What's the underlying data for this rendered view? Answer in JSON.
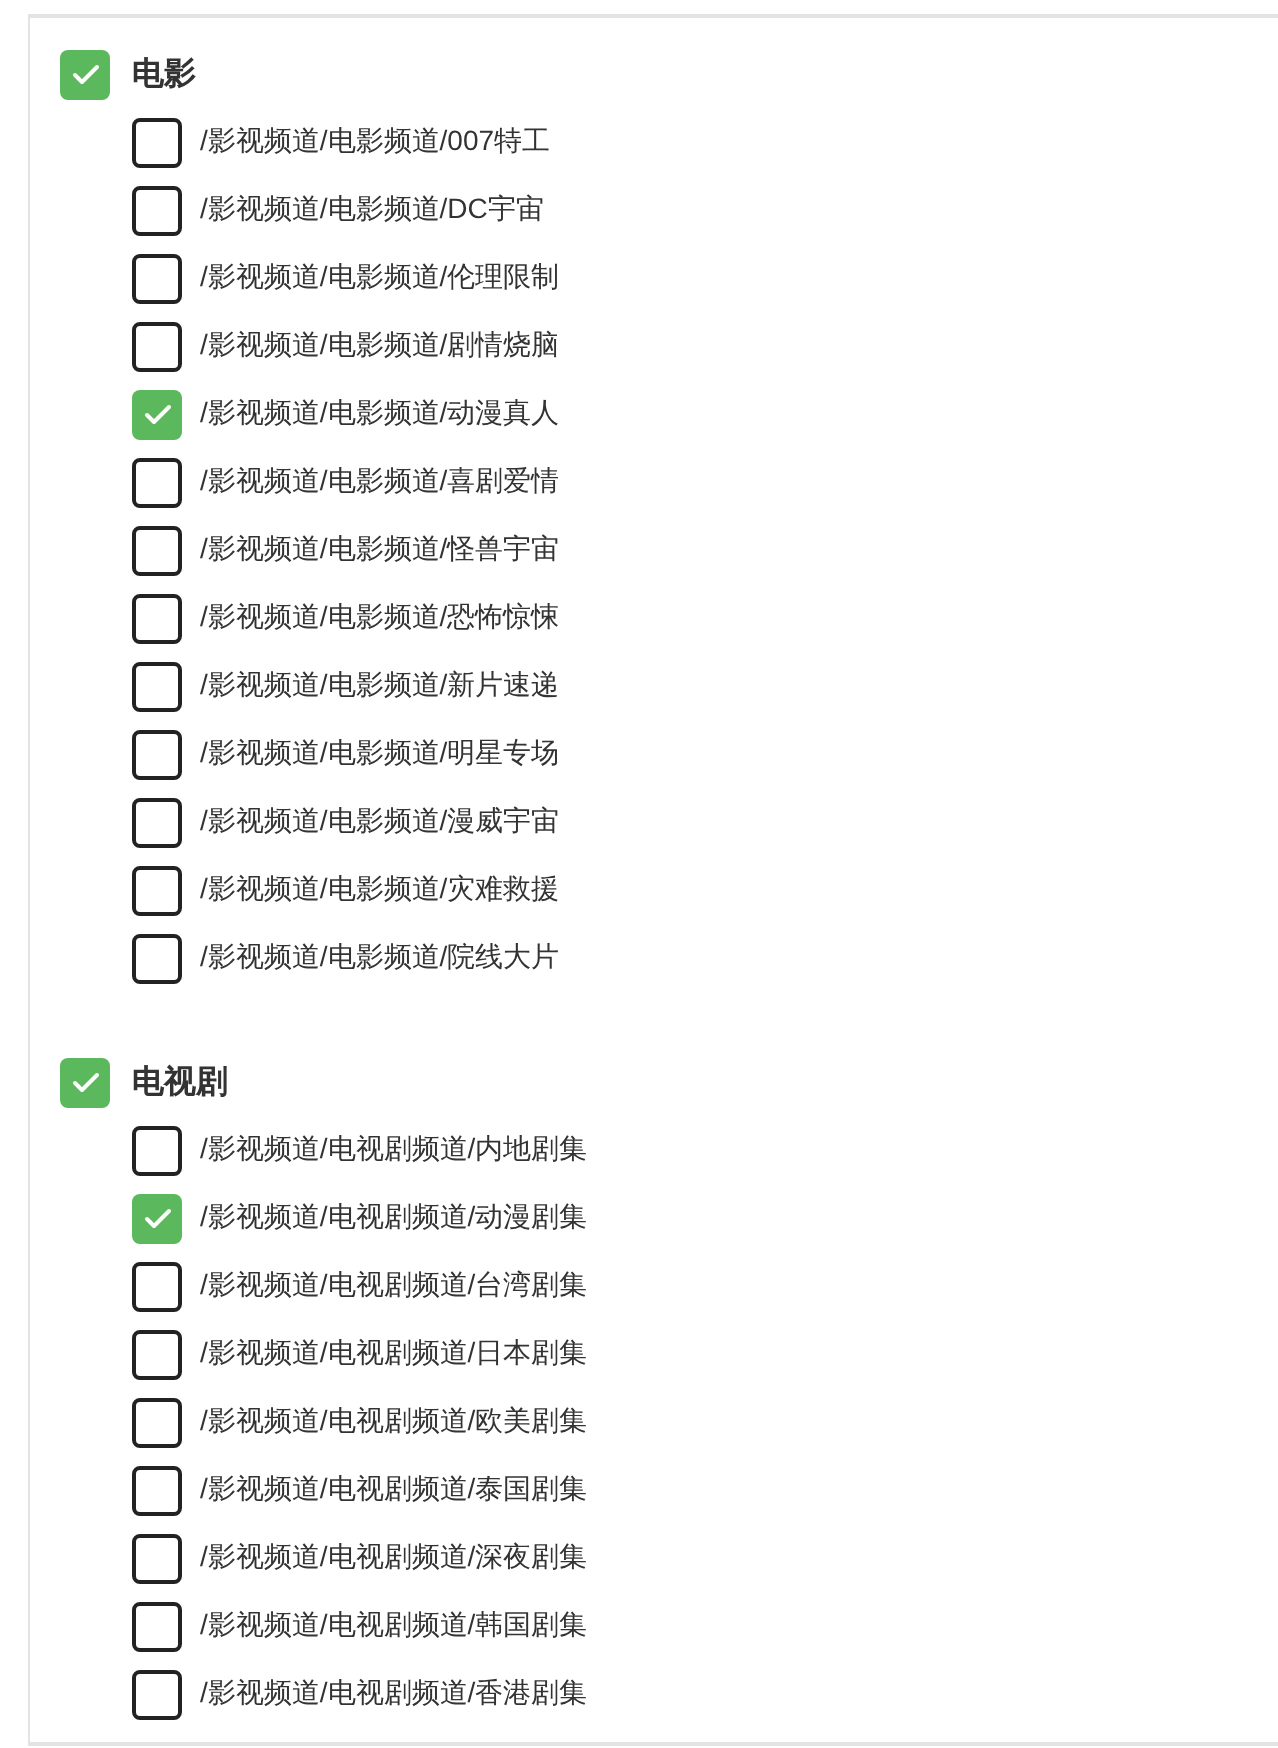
{
  "groups": [
    {
      "label": "电影",
      "checked": true,
      "items": [
        {
          "label": "/影视频道/电影频道/007特工",
          "checked": false
        },
        {
          "label": "/影视频道/电影频道/DC宇宙",
          "checked": false
        },
        {
          "label": "/影视频道/电影频道/伦理限制",
          "checked": false
        },
        {
          "label": "/影视频道/电影频道/剧情烧脑",
          "checked": false
        },
        {
          "label": "/影视频道/电影频道/动漫真人",
          "checked": true
        },
        {
          "label": "/影视频道/电影频道/喜剧爱情",
          "checked": false
        },
        {
          "label": "/影视频道/电影频道/怪兽宇宙",
          "checked": false
        },
        {
          "label": "/影视频道/电影频道/恐怖惊悚",
          "checked": false
        },
        {
          "label": "/影视频道/电影频道/新片速递",
          "checked": false
        },
        {
          "label": "/影视频道/电影频道/明星专场",
          "checked": false
        },
        {
          "label": "/影视频道/电影频道/漫威宇宙",
          "checked": false
        },
        {
          "label": "/影视频道/电影频道/灾难救援",
          "checked": false
        },
        {
          "label": "/影视频道/电影频道/院线大片",
          "checked": false
        }
      ]
    },
    {
      "label": "电视剧",
      "checked": true,
      "items": [
        {
          "label": "/影视频道/电视剧频道/内地剧集",
          "checked": false
        },
        {
          "label": "/影视频道/电视剧频道/动漫剧集",
          "checked": true
        },
        {
          "label": "/影视频道/电视剧频道/台湾剧集",
          "checked": false
        },
        {
          "label": "/影视频道/电视剧频道/日本剧集",
          "checked": false
        },
        {
          "label": "/影视频道/电视剧频道/欧美剧集",
          "checked": false
        },
        {
          "label": "/影视频道/电视剧频道/泰国剧集",
          "checked": false
        },
        {
          "label": "/影视频道/电视剧频道/深夜剧集",
          "checked": false
        },
        {
          "label": "/影视频道/电视剧频道/韩国剧集",
          "checked": false
        },
        {
          "label": "/影视频道/电视剧频道/香港剧集",
          "checked": false
        }
      ]
    }
  ]
}
